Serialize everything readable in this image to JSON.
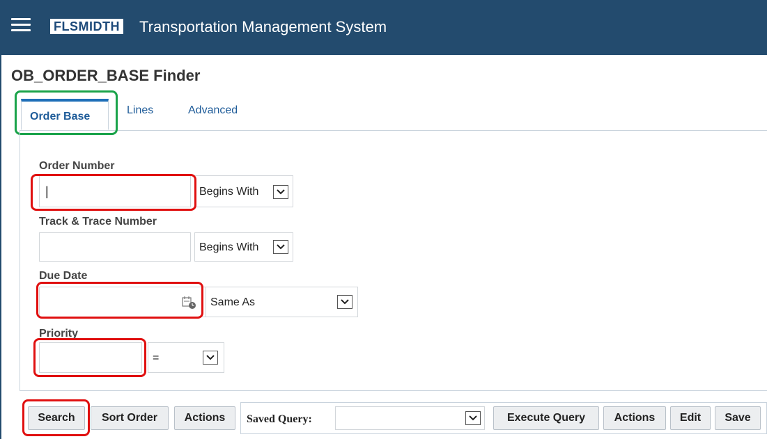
{
  "header": {
    "logo_text": "FLSMIDTH",
    "app_title": "Transportation Management System"
  },
  "page": {
    "title": "OB_ORDER_BASE Finder"
  },
  "tabs": [
    {
      "label": "Order Base",
      "active": true
    },
    {
      "label": "Lines",
      "active": false
    },
    {
      "label": "Advanced",
      "active": false
    }
  ],
  "fields": {
    "order_number": {
      "label": "Order Number",
      "value": "|",
      "operator": "Begins With"
    },
    "track_trace": {
      "label": "Track & Trace Number",
      "value": "",
      "operator": "Begins With"
    },
    "due_date": {
      "label": "Due Date",
      "value": "",
      "operator": "Same As"
    },
    "priority": {
      "label": "Priority",
      "value": "",
      "operator": "="
    }
  },
  "buttons": {
    "search": "Search",
    "sort_order": "Sort Order",
    "actions": "Actions",
    "saved_query_label": "Saved Query:",
    "saved_query_value": "",
    "execute_query": "Execute Query",
    "actions2": "Actions",
    "edit": "Edit",
    "save": "Save"
  },
  "colors": {
    "header_bg": "#234b6e",
    "tab_link": "#1f5c99",
    "highlight_red": "#e01010",
    "highlight_green": "#1aa34a"
  }
}
